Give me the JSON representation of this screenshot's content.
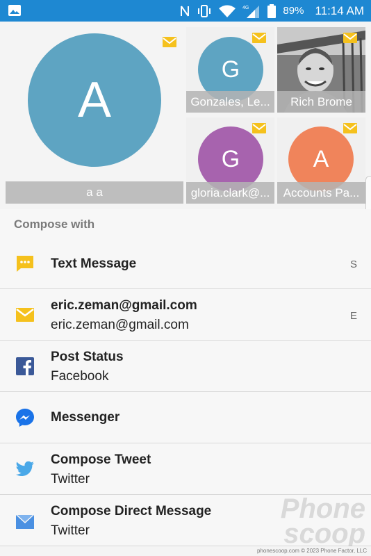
{
  "status_bar": {
    "battery": "89%",
    "time": "11:14 AM",
    "icons": [
      "image-icon",
      "nfc-icon",
      "vibrate-icon",
      "wifi-icon",
      "4g-icon",
      "signal-icon",
      "battery-icon"
    ]
  },
  "contacts": [
    {
      "initial": "A",
      "name": "a a",
      "color": "#5ea4c2"
    },
    {
      "initial": "G",
      "name": "Gonzales, Le...",
      "color": "#5ea4c2"
    },
    {
      "initial": "",
      "name": "Rich Brome",
      "color": "#8a8a8a"
    },
    {
      "initial": "G",
      "name": "gloria.clark@...",
      "color": "#a763ae"
    },
    {
      "initial": "A",
      "name": "Accounts Pa...",
      "color": "#f0845b"
    }
  ],
  "compose": {
    "header": "Compose with",
    "items": [
      {
        "title": "Text Message",
        "subtitle": "",
        "letter": "S",
        "icon": "message-icon",
        "icon_color": "#f5c11d"
      },
      {
        "title": "eric.zeman@gmail.com",
        "subtitle": "eric.zeman@gmail.com",
        "letter": "E",
        "icon": "email-icon",
        "icon_color": "#f5c11d"
      },
      {
        "title": "Post Status",
        "subtitle": "Facebook",
        "letter": "",
        "icon": "facebook-icon",
        "icon_color": "#3b5998"
      },
      {
        "title": "Messenger",
        "subtitle": "",
        "letter": "",
        "icon": "messenger-icon",
        "icon_color": "#1a73e8"
      },
      {
        "title": "Compose Tweet",
        "subtitle": "Twitter",
        "letter": "",
        "icon": "twitter-icon",
        "icon_color": "#4aa8e8"
      },
      {
        "title": "Compose Direct Message",
        "subtitle": "Twitter",
        "letter": "",
        "icon": "direct-message-icon",
        "icon_color": "#4a90e2"
      }
    ]
  },
  "watermark": {
    "line1": "Phone",
    "line2": "scoop"
  },
  "footer": "phonescoop.com  © 2023 Phone Factor, LLC"
}
